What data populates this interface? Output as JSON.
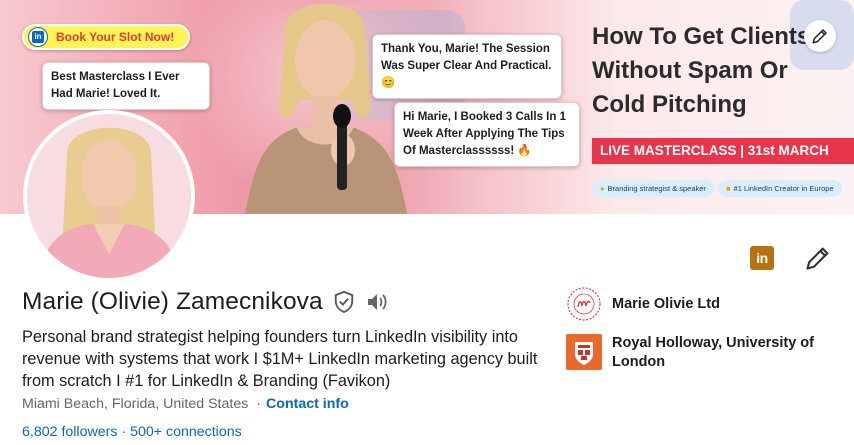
{
  "banner": {
    "book_slot": "Book Your Slot Now!",
    "testimonial_1": "Best Masterclass I Ever Had Marie! Loved It.",
    "testimonial_2": "Thank You, Marie! The Session Was Super Clear And Practical. 😊",
    "testimonial_3": "Hi Marie, I Booked 3 Calls In 1 Week After Applying The Tips Of Masterclassssss! 🔥",
    "headline_line1": "How To Get Clients",
    "headline_line2": "Without Spam Or",
    "headline_line3": "Cold Pitching",
    "live_bar": "LIVE MASTERCLASS | 31st MARCH",
    "tag_1": "Branding strategist & speaker",
    "tag_2": "#1 LinkedIn Creator in Europe",
    "accent_color": "#e8354c",
    "pill_color": "#fff455"
  },
  "profile": {
    "name": "Marie (Olivie) Zamecnikova",
    "tagline": "Personal brand strategist helping founders turn LinkedIn visibility into revenue with systems that work I $1M+ LinkedIn marketing agency built from scratch I #1 for LinkedIn & Branding (Favikon)",
    "location": "Miami Beach, Florida, United States",
    "separator": "·",
    "contact_info": "Contact info",
    "followers": "6,802 followers",
    "stats_separator": "·",
    "connections": "500+ connections",
    "link_color": "#0a66c2"
  },
  "organizations": [
    {
      "name": "Marie Olivie Ltd",
      "logo_icon": "marie-olivie-logo-icon"
    },
    {
      "name": "Royal Holloway, University of London",
      "logo_icon": "royal-holloway-crest-icon"
    }
  ],
  "actions": {
    "linkedin_label": "in"
  }
}
